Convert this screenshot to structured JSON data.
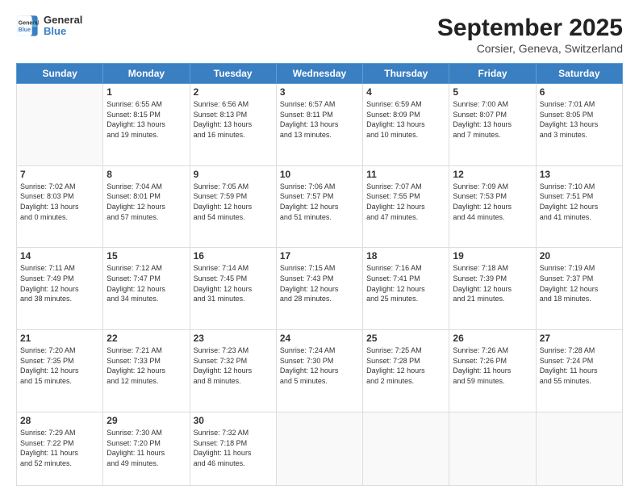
{
  "logo": {
    "line1": "General",
    "line2": "Blue"
  },
  "title": "September 2025",
  "subtitle": "Corsier, Geneva, Switzerland",
  "days_of_week": [
    "Sunday",
    "Monday",
    "Tuesday",
    "Wednesday",
    "Thursday",
    "Friday",
    "Saturday"
  ],
  "weeks": [
    [
      {
        "day": "",
        "info": ""
      },
      {
        "day": "1",
        "info": "Sunrise: 6:55 AM\nSunset: 8:15 PM\nDaylight: 13 hours\nand 19 minutes."
      },
      {
        "day": "2",
        "info": "Sunrise: 6:56 AM\nSunset: 8:13 PM\nDaylight: 13 hours\nand 16 minutes."
      },
      {
        "day": "3",
        "info": "Sunrise: 6:57 AM\nSunset: 8:11 PM\nDaylight: 13 hours\nand 13 minutes."
      },
      {
        "day": "4",
        "info": "Sunrise: 6:59 AM\nSunset: 8:09 PM\nDaylight: 13 hours\nand 10 minutes."
      },
      {
        "day": "5",
        "info": "Sunrise: 7:00 AM\nSunset: 8:07 PM\nDaylight: 13 hours\nand 7 minutes."
      },
      {
        "day": "6",
        "info": "Sunrise: 7:01 AM\nSunset: 8:05 PM\nDaylight: 13 hours\nand 3 minutes."
      }
    ],
    [
      {
        "day": "7",
        "info": "Sunrise: 7:02 AM\nSunset: 8:03 PM\nDaylight: 13 hours\nand 0 minutes."
      },
      {
        "day": "8",
        "info": "Sunrise: 7:04 AM\nSunset: 8:01 PM\nDaylight: 12 hours\nand 57 minutes."
      },
      {
        "day": "9",
        "info": "Sunrise: 7:05 AM\nSunset: 7:59 PM\nDaylight: 12 hours\nand 54 minutes."
      },
      {
        "day": "10",
        "info": "Sunrise: 7:06 AM\nSunset: 7:57 PM\nDaylight: 12 hours\nand 51 minutes."
      },
      {
        "day": "11",
        "info": "Sunrise: 7:07 AM\nSunset: 7:55 PM\nDaylight: 12 hours\nand 47 minutes."
      },
      {
        "day": "12",
        "info": "Sunrise: 7:09 AM\nSunset: 7:53 PM\nDaylight: 12 hours\nand 44 minutes."
      },
      {
        "day": "13",
        "info": "Sunrise: 7:10 AM\nSunset: 7:51 PM\nDaylight: 12 hours\nand 41 minutes."
      }
    ],
    [
      {
        "day": "14",
        "info": "Sunrise: 7:11 AM\nSunset: 7:49 PM\nDaylight: 12 hours\nand 38 minutes."
      },
      {
        "day": "15",
        "info": "Sunrise: 7:12 AM\nSunset: 7:47 PM\nDaylight: 12 hours\nand 34 minutes."
      },
      {
        "day": "16",
        "info": "Sunrise: 7:14 AM\nSunset: 7:45 PM\nDaylight: 12 hours\nand 31 minutes."
      },
      {
        "day": "17",
        "info": "Sunrise: 7:15 AM\nSunset: 7:43 PM\nDaylight: 12 hours\nand 28 minutes."
      },
      {
        "day": "18",
        "info": "Sunrise: 7:16 AM\nSunset: 7:41 PM\nDaylight: 12 hours\nand 25 minutes."
      },
      {
        "day": "19",
        "info": "Sunrise: 7:18 AM\nSunset: 7:39 PM\nDaylight: 12 hours\nand 21 minutes."
      },
      {
        "day": "20",
        "info": "Sunrise: 7:19 AM\nSunset: 7:37 PM\nDaylight: 12 hours\nand 18 minutes."
      }
    ],
    [
      {
        "day": "21",
        "info": "Sunrise: 7:20 AM\nSunset: 7:35 PM\nDaylight: 12 hours\nand 15 minutes."
      },
      {
        "day": "22",
        "info": "Sunrise: 7:21 AM\nSunset: 7:33 PM\nDaylight: 12 hours\nand 12 minutes."
      },
      {
        "day": "23",
        "info": "Sunrise: 7:23 AM\nSunset: 7:32 PM\nDaylight: 12 hours\nand 8 minutes."
      },
      {
        "day": "24",
        "info": "Sunrise: 7:24 AM\nSunset: 7:30 PM\nDaylight: 12 hours\nand 5 minutes."
      },
      {
        "day": "25",
        "info": "Sunrise: 7:25 AM\nSunset: 7:28 PM\nDaylight: 12 hours\nand 2 minutes."
      },
      {
        "day": "26",
        "info": "Sunrise: 7:26 AM\nSunset: 7:26 PM\nDaylight: 11 hours\nand 59 minutes."
      },
      {
        "day": "27",
        "info": "Sunrise: 7:28 AM\nSunset: 7:24 PM\nDaylight: 11 hours\nand 55 minutes."
      }
    ],
    [
      {
        "day": "28",
        "info": "Sunrise: 7:29 AM\nSunset: 7:22 PM\nDaylight: 11 hours\nand 52 minutes."
      },
      {
        "day": "29",
        "info": "Sunrise: 7:30 AM\nSunset: 7:20 PM\nDaylight: 11 hours\nand 49 minutes."
      },
      {
        "day": "30",
        "info": "Sunrise: 7:32 AM\nSunset: 7:18 PM\nDaylight: 11 hours\nand 46 minutes."
      },
      {
        "day": "",
        "info": ""
      },
      {
        "day": "",
        "info": ""
      },
      {
        "day": "",
        "info": ""
      },
      {
        "day": "",
        "info": ""
      }
    ]
  ]
}
